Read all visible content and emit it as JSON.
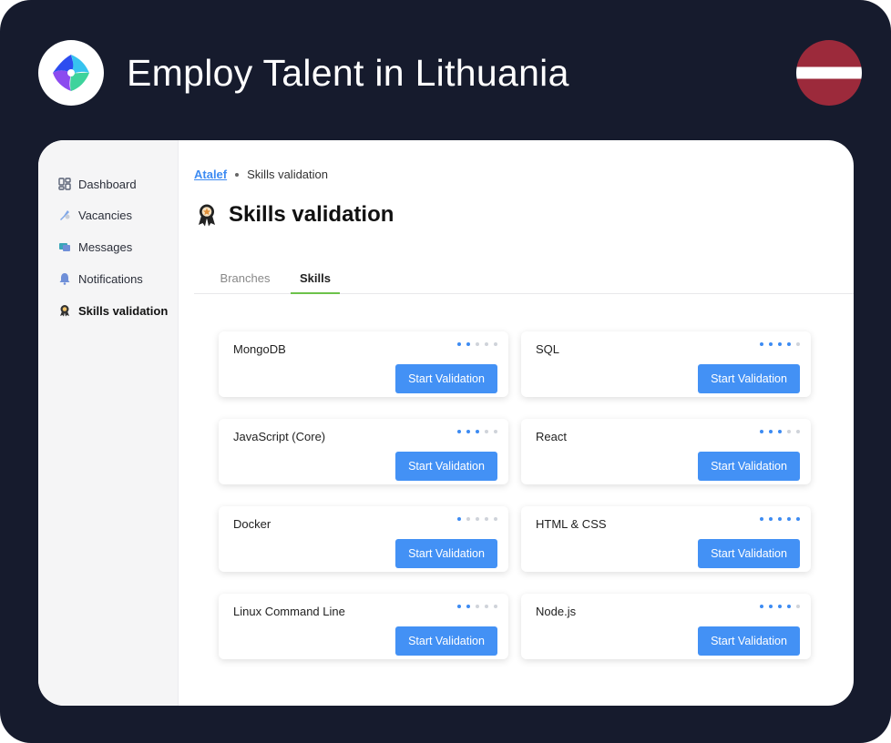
{
  "banner": {
    "headline": "Employ Talent in Lithuania",
    "flag_colors": [
      "#9c2a3b",
      "#ffffff",
      "#9c2a3b"
    ]
  },
  "sidebar": {
    "items": [
      {
        "label": "Dashboard",
        "icon": "dashboard-icon",
        "active": false
      },
      {
        "label": "Vacancies",
        "icon": "vacancies-icon",
        "active": false
      },
      {
        "label": "Messages",
        "icon": "messages-icon",
        "active": false
      },
      {
        "label": "Notifications",
        "icon": "bell-icon",
        "active": false
      },
      {
        "label": "Skills validation",
        "icon": "award-icon",
        "active": true
      }
    ]
  },
  "breadcrumb": {
    "root": "Atalef",
    "current": "Skills validation"
  },
  "page": {
    "title": "Skills validation",
    "icon": "award-icon"
  },
  "tabs": [
    {
      "label": "Branches",
      "active": false
    },
    {
      "label": "Skills",
      "active": true
    }
  ],
  "skills": [
    {
      "name": "MongoDB",
      "level": 2,
      "button": "Start Validation"
    },
    {
      "name": "SQL",
      "level": 4,
      "button": "Start Validation"
    },
    {
      "name": "JavaScript (Core)",
      "level": 3,
      "button": "Start Validation"
    },
    {
      "name": "React",
      "level": 3,
      "button": "Start Validation"
    },
    {
      "name": "Docker",
      "level": 1,
      "button": "Start Validation"
    },
    {
      "name": "HTML & CSS",
      "level": 5,
      "button": "Start Validation"
    },
    {
      "name": "Linux Command Line",
      "level": 2,
      "button": "Start Validation"
    },
    {
      "name": "Node.js",
      "level": 4,
      "button": "Start Validation"
    }
  ],
  "rating_max": 5,
  "colors": {
    "accent": "#4391f5",
    "tab_underline": "#6cc24a",
    "background": "#161b2d"
  }
}
